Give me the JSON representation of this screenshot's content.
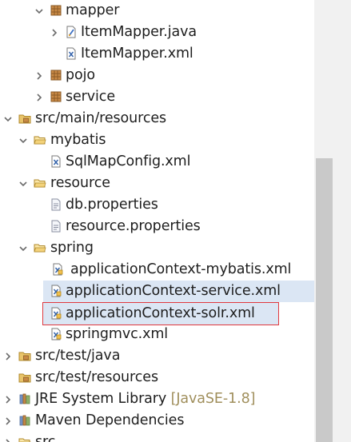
{
  "tree": {
    "mapper": "mapper",
    "item_mapper_java": "ItemMapper.java",
    "item_mapper_xml": "ItemMapper.xml",
    "pojo": "pojo",
    "service": "service",
    "src_main_resources": "src/main/resources",
    "mybatis": "mybatis",
    "sql_map_config": "SqlMapConfig.xml",
    "resource": "resource",
    "db_properties": "db.properties",
    "resource_properties": "resource.properties",
    "spring": "spring",
    "app_ctx_mybatis": "applicationContext-mybatis.xml",
    "app_ctx_service": "applicationContext-service.xml",
    "app_ctx_solr": "applicationContext-solr.xml",
    "springmvc": "springmvc.xml",
    "src_test_java": "src/test/java",
    "src_test_resources": "src/test/resources",
    "jre_library": "JRE System Library",
    "jre_decoration": "[JavaSE-1.8]",
    "maven_deps": "Maven Dependencies",
    "src": "src"
  },
  "colors": {
    "highlight": "#dbe6f4",
    "selection_box": "#e0393e",
    "package_icon": "#b5793c",
    "folder_icon": "#e9c46a",
    "decoration_text": "#a08f5c"
  },
  "icons": {
    "expanded": "chevron-down-icon",
    "collapsed": "chevron-right-icon",
    "package": "package-icon",
    "java_file": "java-file-icon",
    "xml_file": "xml-file-icon",
    "properties_file": "properties-file-icon",
    "source_folder": "source-folder-icon",
    "folder": "open-folder-icon",
    "library": "library-icon"
  }
}
